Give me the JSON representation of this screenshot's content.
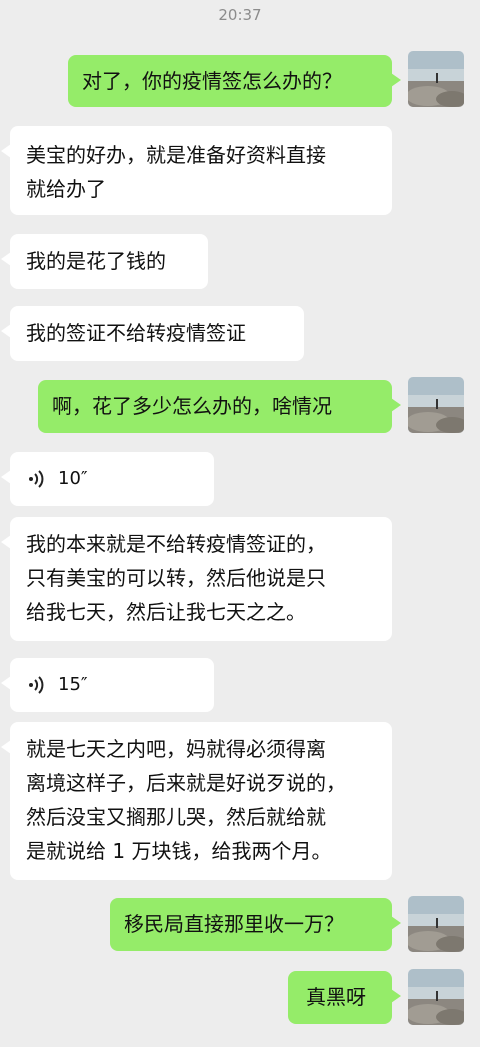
{
  "status": {
    "time": "20:37"
  },
  "messages": [
    {
      "side": "right",
      "type": "text",
      "text": "对了，你的疫情签怎么办的？"
    },
    {
      "side": "left",
      "type": "text",
      "lines": [
        "美宝的好办，就是准备好资料直接",
        "就给办了"
      ]
    },
    {
      "side": "left",
      "type": "text",
      "text": "我的是花了钱的"
    },
    {
      "side": "left",
      "type": "text",
      "text": "我的签证不给转疫情签证"
    },
    {
      "side": "right",
      "type": "text",
      "text": "啊，花了多少怎么办的，啥情况"
    },
    {
      "side": "left",
      "type": "voice",
      "duration": "10″"
    },
    {
      "side": "left",
      "type": "text",
      "lines": [
        "我的本来就是不给转疫情签证的，",
        "只有美宝的可以转，然后他说是只",
        "给我七天，然后让我七天之之。"
      ]
    },
    {
      "side": "left",
      "type": "voice",
      "duration": "15″"
    },
    {
      "side": "left",
      "type": "text",
      "lines": [
        "就是七天之内吧，妈就得必须得离",
        "离境这样子，后来就是好说歹说的，",
        "然后没宝又搁那儿哭，然后就给就",
        "是就说给 1 万块钱，给我两个月。"
      ]
    },
    {
      "side": "right",
      "type": "text",
      "text": "移民局直接那里收一万？"
    },
    {
      "side": "right",
      "type": "text",
      "text": "真黑呀"
    }
  ]
}
